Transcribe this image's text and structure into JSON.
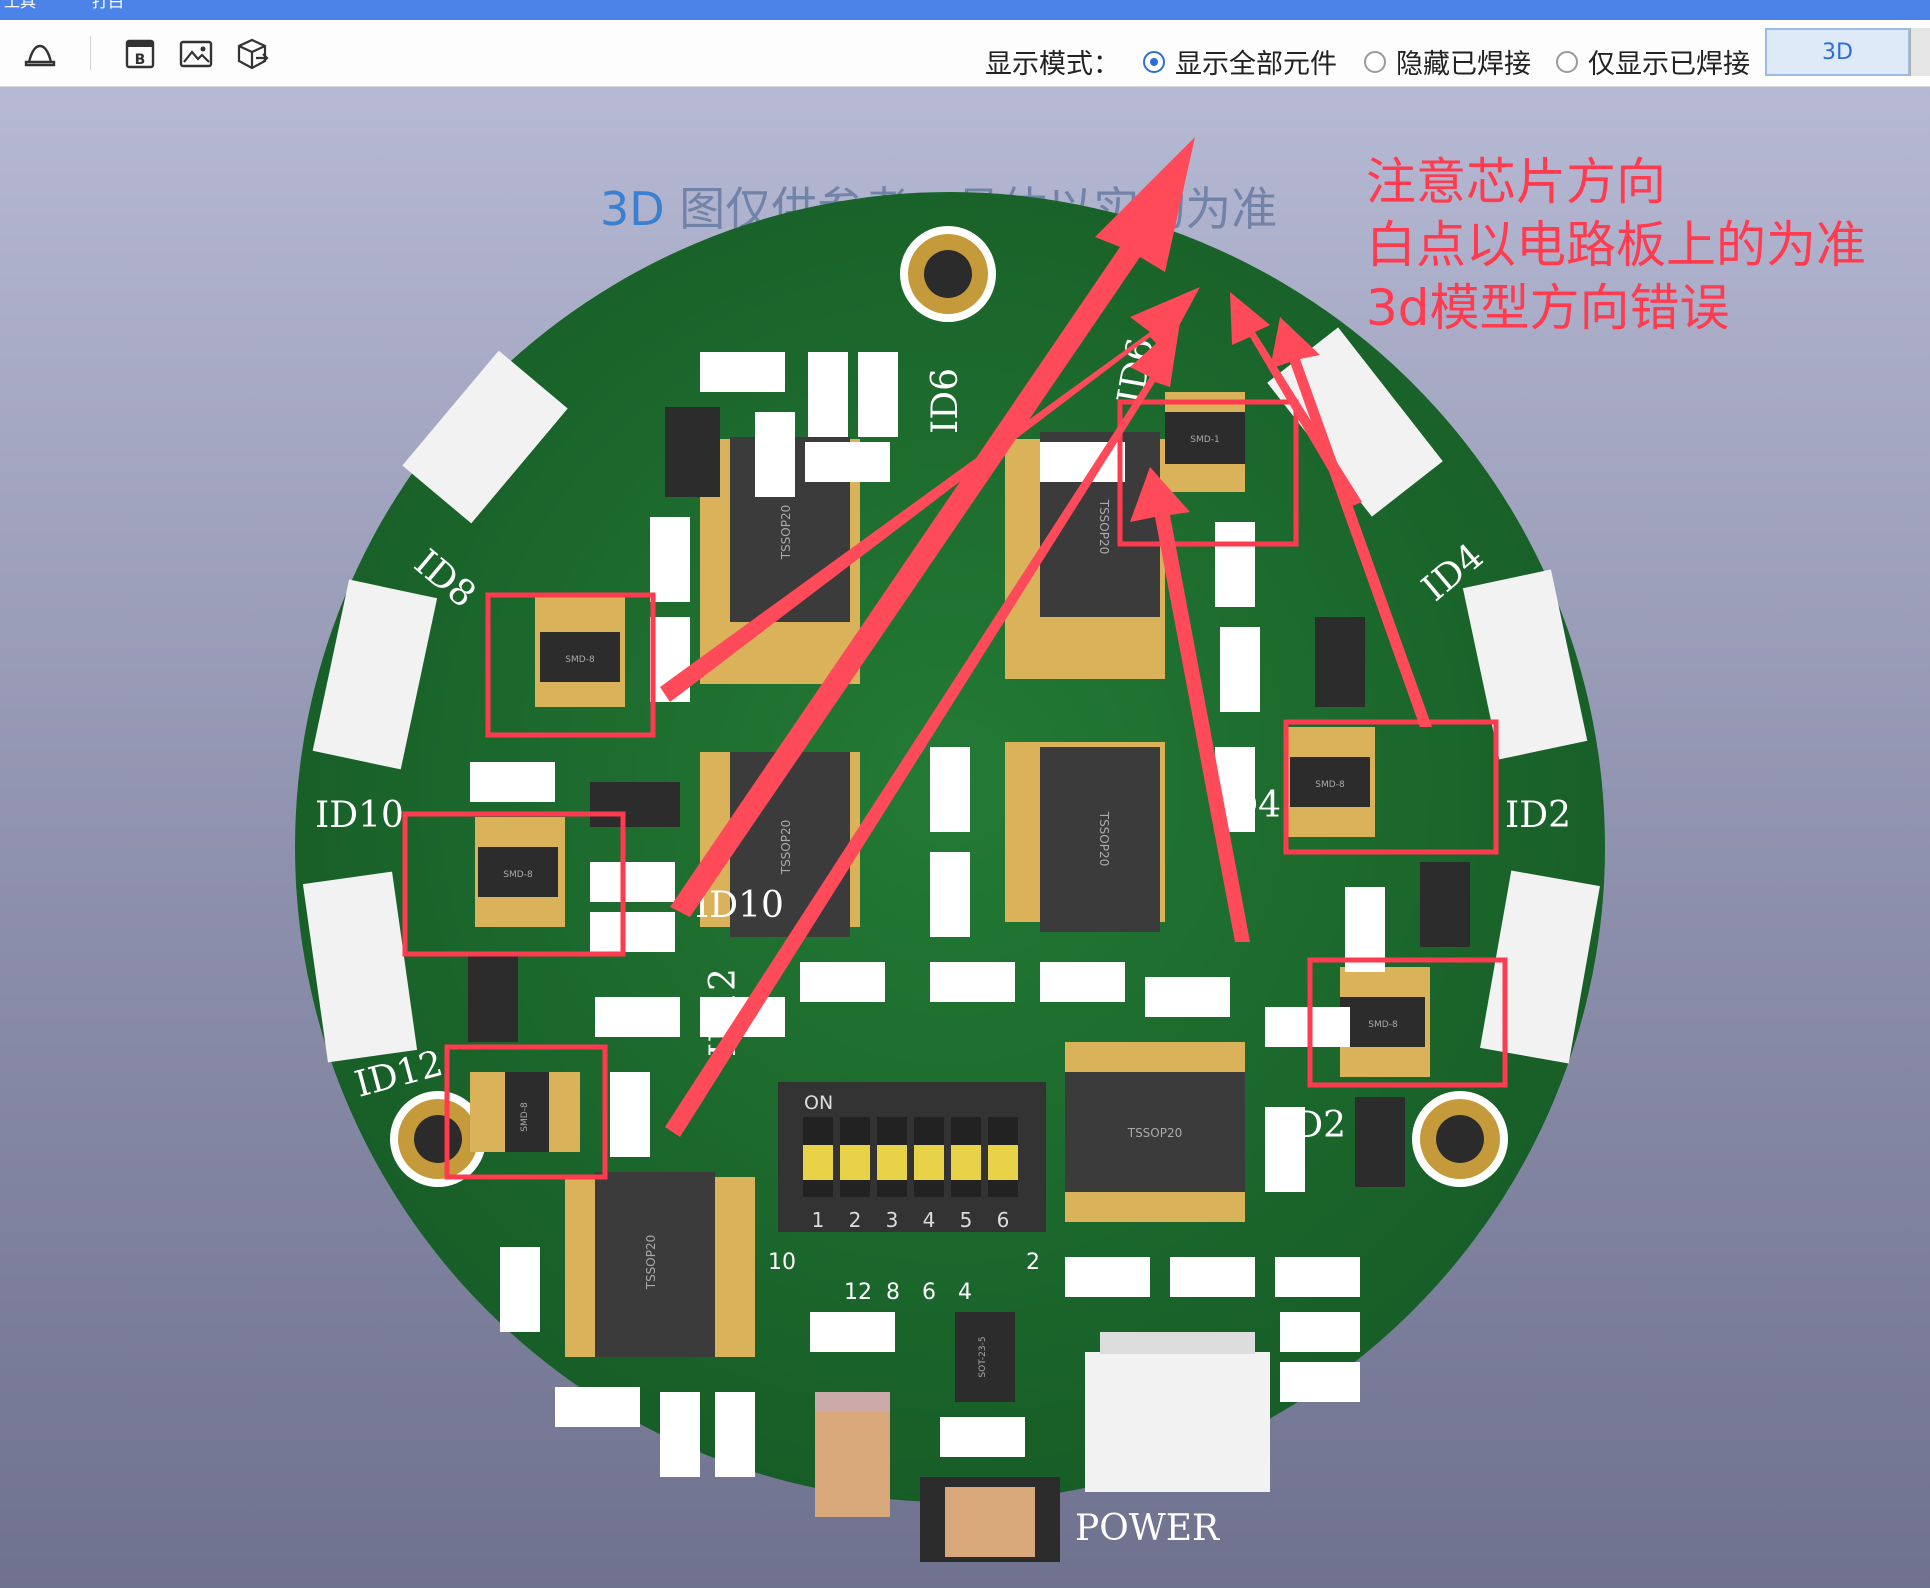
{
  "window": {
    "title_left": "工具",
    "title_right": "打白"
  },
  "toolbar": {
    "icons": [
      "home-icon",
      "pcb-b-icon",
      "image-icon",
      "3d-export-icon"
    ],
    "display_mode_label": "显示模式：",
    "modes": [
      {
        "label": "显示全部元件",
        "selected": true
      },
      {
        "label": "隐藏已焊接",
        "selected": false
      },
      {
        "label": "仅显示已焊接",
        "selected": false
      }
    ],
    "view_button": "3D"
  },
  "viewport": {
    "notice_prefix": "3D",
    "notice_text": " 图仅供参考，具体以实物为准",
    "annotation_lines": [
      "注意芯片方向",
      "白点以电路板上的为准",
      "3d模型方向错误"
    ],
    "annotation_color": "#ff3b4f"
  },
  "board": {
    "silk_labels": [
      "ID8",
      "ID10",
      "ID12",
      "ID6",
      "ID4",
      "ID2",
      "ID10",
      "ID12",
      "ID4",
      "ID2",
      "POWER",
      "ID6"
    ],
    "ic_labels": [
      "TSSOP20",
      "TSSOP20",
      "TSSOP20",
      "TSSOP20",
      "TSSOP20",
      "TSSOP20"
    ],
    "small_ic_labels": [
      "SMD-1",
      "SMD-8",
      "SMD-8",
      "SMD-8",
      "SMD-8",
      "SMD-8",
      "SOT-23-5"
    ],
    "dip_switch": {
      "on_label": "ON",
      "numbers": [
        "1",
        "2",
        "3",
        "4",
        "5",
        "6"
      ],
      "pin_labels": [
        "10",
        "12",
        "8",
        "6",
        "4",
        "2"
      ]
    }
  },
  "colors": {
    "pcb": "#1d6b2e",
    "pad": "#d9b25a",
    "arrow": "#ff4a5a",
    "box": "#ff3b4f"
  }
}
